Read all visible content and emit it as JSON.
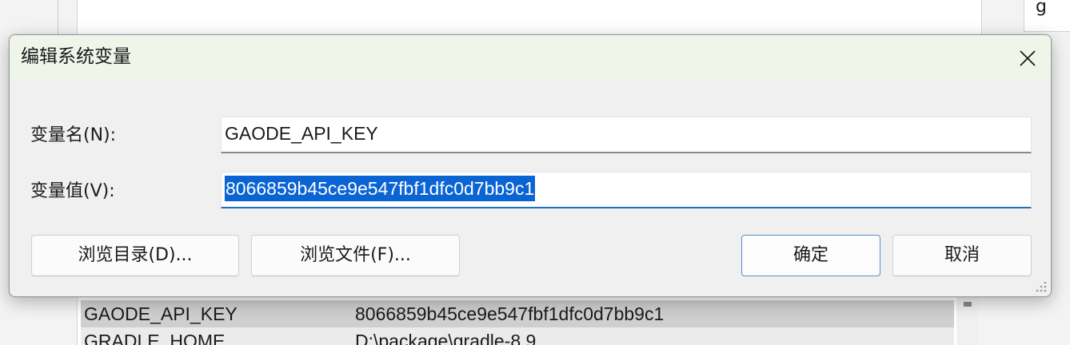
{
  "background": {
    "right_box_char": "g",
    "list_rows": [
      {
        "name": "GAODE_API_KEY",
        "value": "8066859b45ce9e547fbf1dfc0d7bb9c1"
      },
      {
        "name": "GRADLE_HOME",
        "value": "D:\\package\\gradle-8.9"
      }
    ]
  },
  "dialog": {
    "title": "编辑系统变量",
    "close_icon": "close-icon",
    "name_label": "变量名(N):",
    "name_value": "GAODE_API_KEY",
    "value_label": "变量值(V):",
    "value_value": "8066859b45ce9e547fbf1dfc0d7bb9c1",
    "buttons": {
      "browse_dir": "浏览目录(D)...",
      "browse_file": "浏览文件(F)...",
      "ok": "确定",
      "cancel": "取消"
    }
  },
  "colors": {
    "title_bar": "#eff5e9",
    "selection": "#0a64d4",
    "accent": "#1f6fc1"
  }
}
